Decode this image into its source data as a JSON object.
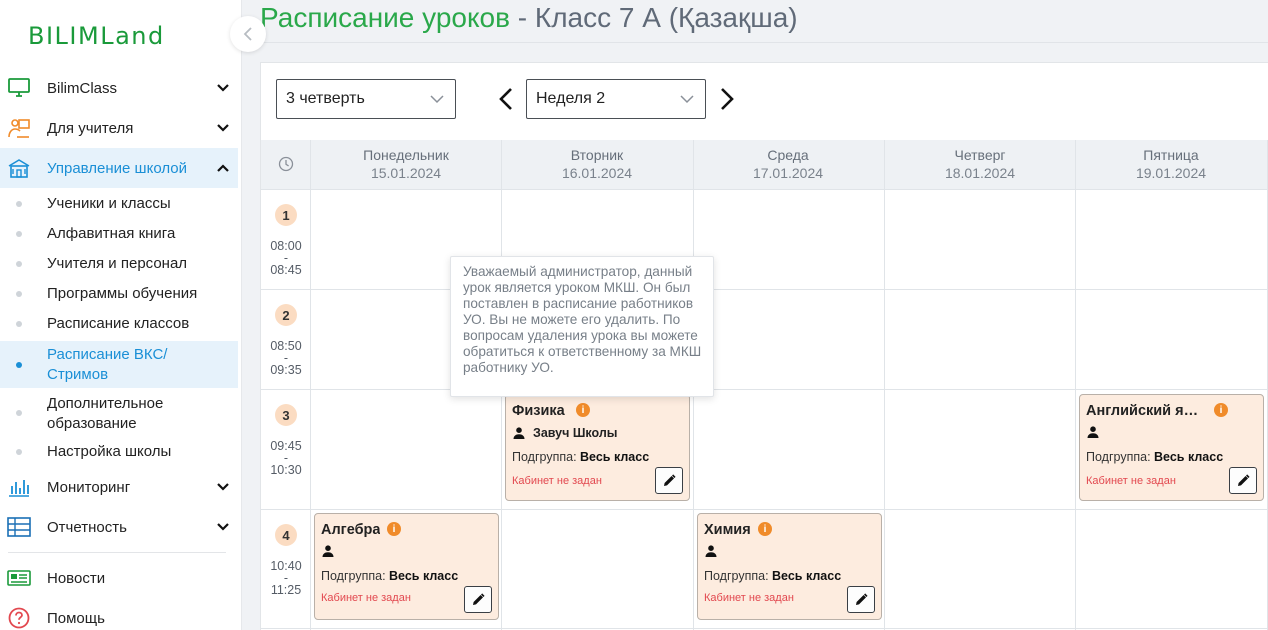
{
  "brand": {
    "logo_text": "BILIMLand",
    "accent": "#1a9a3a"
  },
  "sidebar": {
    "items": [
      {
        "label": "BilimClass",
        "icon": "monitor-icon"
      },
      {
        "label": "Для учителя",
        "icon": "teacher-icon"
      },
      {
        "label": "Управление школой",
        "icon": "school-icon",
        "active": true,
        "expanded": true
      }
    ],
    "sub_items": [
      {
        "label": "Ученики и классы"
      },
      {
        "label": "Алфавитная книга"
      },
      {
        "label": "Учителя и персонал"
      },
      {
        "label": "Программы обучения"
      },
      {
        "label": "Расписание классов"
      },
      {
        "label": "Расписание ВКС/ Стримов",
        "active": true
      },
      {
        "label": "Дополнительное образование"
      },
      {
        "label": "Настройка школы"
      }
    ],
    "items_after": [
      {
        "label": "Мониторинг",
        "icon": "chart-bars-icon"
      },
      {
        "label": "Отчетность",
        "icon": "table-icon"
      }
    ],
    "bottom_items": [
      {
        "label": "Новости",
        "icon": "news-icon"
      },
      {
        "label": "Помощь",
        "icon": "help-icon"
      }
    ]
  },
  "header": {
    "title": "Расписание уроков",
    "subtitle": " - Класс 7 А (Қазақша)"
  },
  "filters": {
    "quarter": "3 четверть",
    "week": "Неделя 2"
  },
  "schedule": {
    "days": [
      {
        "name": "Понедельник",
        "date": "15.01.2024"
      },
      {
        "name": "Вторник",
        "date": "16.01.2024"
      },
      {
        "name": "Среда",
        "date": "17.01.2024"
      },
      {
        "name": "Четверг",
        "date": "18.01.2024"
      },
      {
        "name": "Пятница",
        "date": "19.01.2024"
      }
    ],
    "slots": [
      {
        "no": "1",
        "start": "08:00",
        "sep": "-",
        "end": "08:45"
      },
      {
        "no": "2",
        "start": "08:50",
        "sep": "-",
        "end": "09:35"
      },
      {
        "no": "3",
        "start": "09:45",
        "sep": "-",
        "end": "10:30"
      },
      {
        "no": "4",
        "start": "10:40",
        "sep": "-",
        "end": "11:25"
      }
    ],
    "lessons": [
      {
        "subject": "Физика",
        "teacher": "Завуч Школы",
        "group_label": "Подгруппа: ",
        "group": "Весь класс",
        "room": "Кабинет не задан"
      },
      {
        "subject": "Английский язык",
        "teacher": "",
        "group_label": "Подгруппа: ",
        "group": "Весь класс",
        "room": "Кабинет не задан"
      },
      {
        "subject": "Алгебра",
        "teacher": "",
        "group_label": "Подгруппа: ",
        "group": "Весь класс",
        "room": "Кабинет не задан"
      },
      {
        "subject": "Химия",
        "teacher": "",
        "group_label": "Подгруппа: ",
        "group": "Весь класс",
        "room": "Кабинет не задан"
      }
    ]
  },
  "tooltip": {
    "text": "Уважаемый администратор, данный урок является уроком МКШ. Он был поставлен в расписание работников УО. Вы не можете его удалить. По вопросам удаления урока вы можете обратиться к ответственному за МКШ работнику УО."
  }
}
